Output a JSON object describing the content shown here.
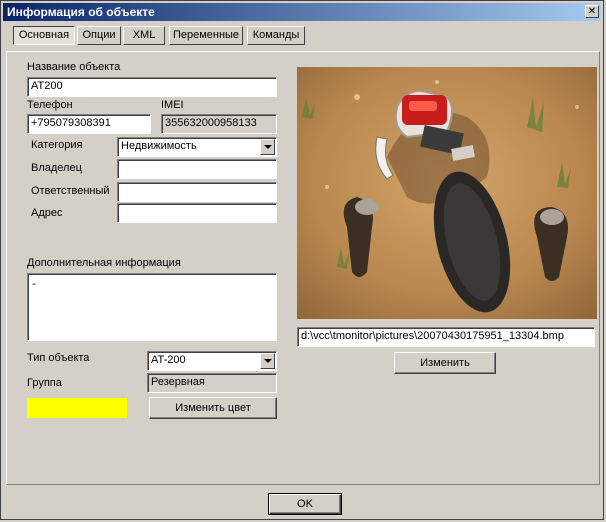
{
  "window": {
    "title": "Информация об объекте",
    "close_label": "✕"
  },
  "tabs": [
    "Основная",
    "Опции",
    "XML",
    "Переменные",
    "Команды"
  ],
  "form": {
    "name_label": "Название объекта",
    "name_value": "AT200",
    "phone_label": "Телефон",
    "phone_value": "+795079308391",
    "imei_label": "IMEI",
    "imei_value": "355632000958133",
    "category_label": "Категория",
    "category_value": "Недвижимость",
    "owner_label": "Владелец",
    "owner_value": "",
    "responsible_label": "Ответственный",
    "responsible_value": "",
    "address_label": "Адрес",
    "address_value": "",
    "extra_label": "Дополнительная информация",
    "extra_value": "-",
    "type_label": "Тип объекта",
    "type_value": "AT-200",
    "group_label": "Группа",
    "group_value": "Резервная",
    "color_swatch": "#ffff00",
    "change_color_label": "Изменить цвет"
  },
  "image": {
    "path": "d:\\vcc\\tmonitor\\pictures\\20070430175951_13304.bmp",
    "change_label": "Изменить"
  },
  "footer": {
    "ok_label": "OK"
  }
}
